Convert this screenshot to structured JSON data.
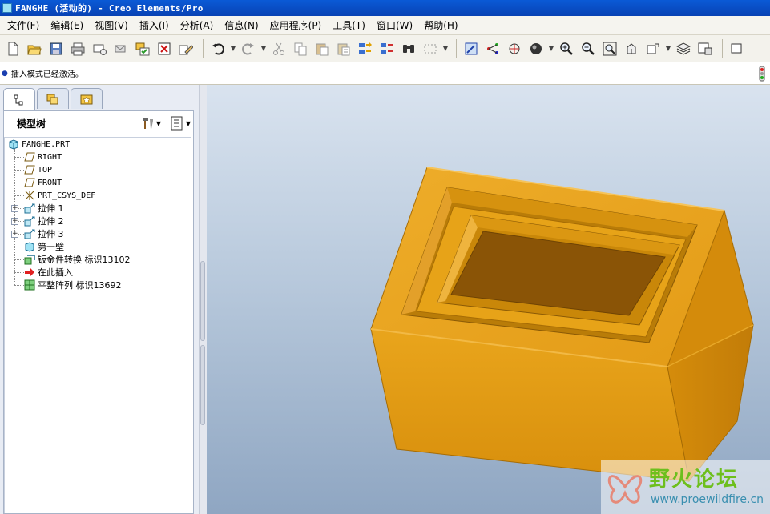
{
  "window": {
    "title": "FANGHE (活动的) - Creo Elements/Pro"
  },
  "menu": [
    "文件(F)",
    "编辑(E)",
    "视图(V)",
    "插入(I)",
    "分析(A)",
    "信息(N)",
    "应用程序(P)",
    "工具(T)",
    "窗口(W)",
    "帮助(H)"
  ],
  "toolbar": {
    "icons": [
      "new-file-icon",
      "open-folder-icon",
      "save-icon",
      "print-icon",
      "email-icon",
      "send-icon",
      "copy-window-icon",
      "close-window-icon",
      "erase-icon",
      "undo-icon",
      "redo-icon",
      "cut-icon",
      "copy-icon",
      "paste-icon",
      "paste-special-icon",
      "regenerate-icon",
      "regen-manager-icon",
      "find-icon",
      "select-box-icon",
      "repaint-icon",
      "datum-display-icon",
      "spin-center-icon",
      "shading-icon",
      "zoom-in-icon",
      "zoom-out-icon",
      "refit-icon",
      "reorient-icon",
      "saved-views-icon",
      "layers-icon",
      "view-manager-icon"
    ]
  },
  "message": {
    "text": "插入模式已经激活。"
  },
  "navigator": {
    "tabs": [
      "model-tree-tab",
      "folder-browser-tab",
      "favorites-tab"
    ],
    "header": "模型树",
    "tree": [
      {
        "label": "FANGHE.PRT",
        "icon": "part-icon",
        "mono": true,
        "expander": false
      },
      {
        "label": "RIGHT",
        "icon": "datum-plane-icon",
        "mono": true,
        "expander": false
      },
      {
        "label": "TOP",
        "icon": "datum-plane-icon",
        "mono": true,
        "expander": false
      },
      {
        "label": "FRONT",
        "icon": "datum-plane-icon",
        "mono": true,
        "expander": false
      },
      {
        "label": "PRT_CSYS_DEF",
        "icon": "csys-icon",
        "mono": true,
        "expander": false
      },
      {
        "label": "拉伸 1",
        "icon": "extrude-icon",
        "mono": false,
        "expander": true
      },
      {
        "label": "拉伸 2",
        "icon": "extrude-icon",
        "mono": false,
        "expander": true
      },
      {
        "label": "拉伸 3",
        "icon": "extrude-icon",
        "mono": false,
        "expander": true
      },
      {
        "label": "第一壁",
        "icon": "first-wall-icon",
        "mono": false,
        "expander": false
      },
      {
        "label": "钣金件转换 标识13102",
        "icon": "sheetmetal-convert-icon",
        "mono": false,
        "expander": false
      },
      {
        "label": "在此插入",
        "icon": "insert-here-arrow-icon",
        "mono": false,
        "expander": false
      },
      {
        "label": "平整阵列 标识13692",
        "icon": "flat-pattern-icon",
        "mono": false,
        "expander": false
      }
    ]
  },
  "watermark": {
    "text": "野火论坛",
    "url": "www.proewildfire.cn"
  },
  "colors": {
    "part": "#e6a31a",
    "part_dark": "#b7790c",
    "part_shadow": "#8a5a06",
    "titlebar": "#0842b4"
  }
}
